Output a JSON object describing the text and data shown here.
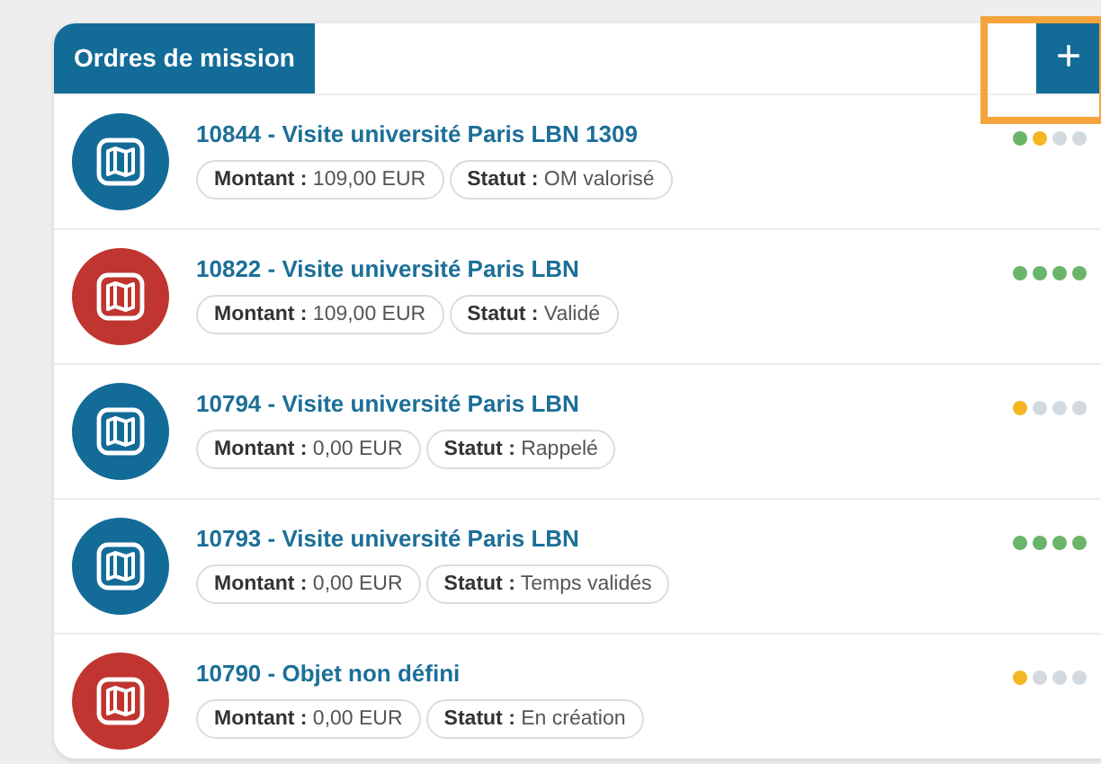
{
  "panel": {
    "title": "Ordres de mission",
    "add_button": {
      "label": "+",
      "highlighted": true
    }
  },
  "orders": [
    {
      "title": "10844 - Visite université Paris LBN 1309",
      "color": "#136b98",
      "fields": [
        {
          "label": "Montant :",
          "value": "109,00 EUR"
        },
        {
          "label": "Statut :",
          "value": "OM valorisé"
        }
      ],
      "steps": [
        {
          "color": "#6ab56a"
        },
        {
          "color": "#f5b623"
        },
        {
          "color": "#d3dadf"
        },
        {
          "color": "#d3dadf"
        }
      ]
    },
    {
      "title": "10822 - Visite université Paris LBN",
      "color": "#c0352f",
      "fields": [
        {
          "label": "Montant :",
          "value": "109,00 EUR"
        },
        {
          "label": "Statut :",
          "value": "Validé"
        }
      ],
      "steps": [
        {
          "color": "#6ab56a"
        },
        {
          "color": "#6ab56a"
        },
        {
          "color": "#6ab56a"
        },
        {
          "color": "#6ab56a"
        }
      ]
    },
    {
      "title": "10794 - Visite université Paris LBN",
      "color": "#136b98",
      "fields": [
        {
          "label": "Montant :",
          "value": "0,00 EUR"
        },
        {
          "label": "Statut :",
          "value": "Rappelé"
        }
      ],
      "steps": [
        {
          "color": "#f5b623"
        },
        {
          "color": "#d3dadf"
        },
        {
          "color": "#d3dadf"
        },
        {
          "color": "#d3dadf"
        }
      ]
    },
    {
      "title": "10793 - Visite université Paris LBN",
      "color": "#136b98",
      "fields": [
        {
          "label": "Montant :",
          "value": "0,00 EUR"
        },
        {
          "label": "Statut :",
          "value": "Temps validés"
        }
      ],
      "steps": [
        {
          "color": "#6ab56a"
        },
        {
          "color": "#6ab56a"
        },
        {
          "color": "#6ab56a"
        },
        {
          "color": "#6ab56a"
        }
      ]
    },
    {
      "title": "10790 - Objet non défini",
      "color": "#c0352f",
      "fields": [
        {
          "label": "Montant :",
          "value": "0,00 EUR"
        },
        {
          "label": "Statut :",
          "value": "En création"
        }
      ],
      "steps": [
        {
          "color": "#f5b623"
        },
        {
          "color": "#d3dadf"
        },
        {
          "color": "#d3dadf"
        },
        {
          "color": "#d3dadf"
        }
      ]
    }
  ]
}
